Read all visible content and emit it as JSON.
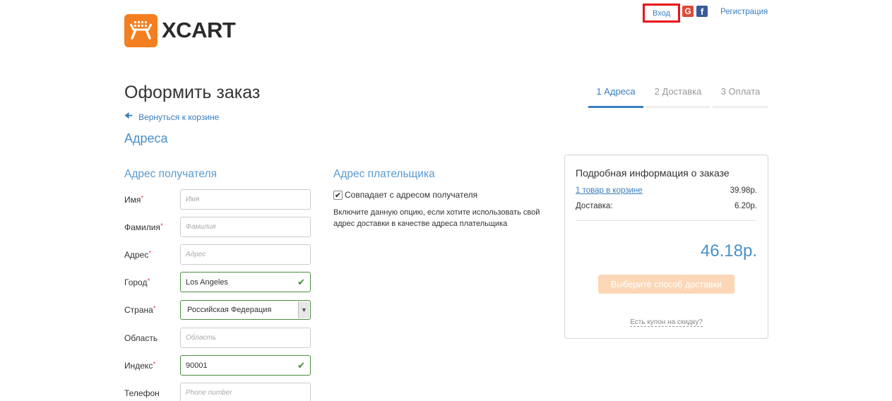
{
  "header": {
    "logo_text": "XCART",
    "login_label": "Вход",
    "google_glyph": "G",
    "facebook_glyph": "f",
    "register_label": "Регистрация"
  },
  "page": {
    "title": "Оформить заказ",
    "back_label": "Вернуться к корзине",
    "section_title": "Адреса"
  },
  "steps": [
    {
      "label": "1 Адреса",
      "state": "active"
    },
    {
      "label": "2 Доставка",
      "state": "inactive"
    },
    {
      "label": "3 Оплата",
      "state": "inactive"
    }
  ],
  "shipping": {
    "heading": "Адрес получателя",
    "required_mark": "*",
    "fields": [
      {
        "label": "Имя",
        "required": true,
        "value": "",
        "placeholder": "Имя"
      },
      {
        "label": "Фамилия",
        "required": true,
        "value": "",
        "placeholder": "Фамилия"
      },
      {
        "label": "Адрес",
        "required": true,
        "value": "",
        "placeholder": "Адрес"
      },
      {
        "label": "Город",
        "required": true,
        "value": "Los Angeles",
        "placeholder": "",
        "valid": true
      },
      {
        "label": "Страна",
        "required": true,
        "value": "Российская Федерация",
        "type": "select"
      },
      {
        "label": "Область",
        "required": false,
        "value": "",
        "placeholder": "Область"
      },
      {
        "label": "Индекс",
        "required": true,
        "value": "90001",
        "placeholder": "",
        "valid": true
      },
      {
        "label": "Телефон",
        "required": false,
        "value": "",
        "placeholder": "Phone number"
      }
    ]
  },
  "billing": {
    "heading": "Адрес плательщика",
    "same_as_shipping_label": "Совпадает с адресом получателя",
    "same_as_shipping_checked": true,
    "hint": "Включите данную опцию, если хотите использовать свой адрес доставки в качестве адреса плательщика"
  },
  "summary": {
    "title": "Подробная информация о заказе",
    "items_label": "1 товар в корзине",
    "items_amount": "39.98р.",
    "shipping_label": "Доставка:",
    "shipping_amount": "6.20р.",
    "total": "46.18р.",
    "ship_button_label": "Выберите способ доставки",
    "coupon_label": "Есть купон на скидку?"
  },
  "colors": {
    "accent": "#3a7ec0",
    "logo_orange": "#f47f20",
    "valid_green": "#4a8e3d",
    "highlight_red": "#e8141b",
    "disabled_button": "#fbd7b6"
  }
}
